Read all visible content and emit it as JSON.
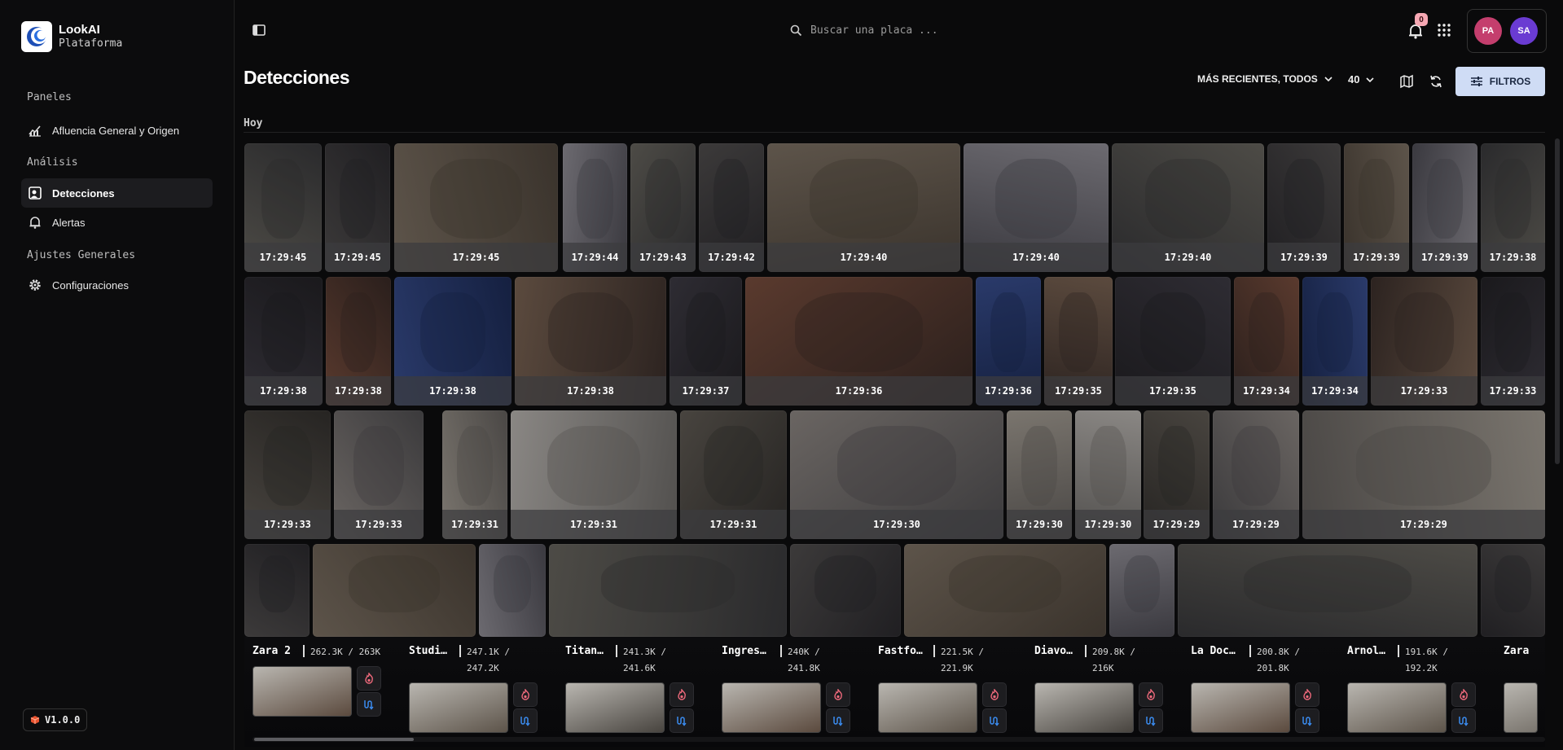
{
  "brand": {
    "name": "LookAI",
    "subtitle": "Plataforma"
  },
  "sidebar": {
    "sections": {
      "paneles": "Paneles",
      "analisis": "Análisis",
      "ajustes": "Ajustes Generales"
    },
    "items": [
      {
        "label": "Afluencia General y Origen",
        "icon": "chart-line-icon"
      },
      {
        "label": "Detecciones",
        "icon": "detections-icon",
        "active": true
      },
      {
        "label": "Alertas",
        "icon": "bell-icon"
      },
      {
        "label": "Configuraciones",
        "icon": "gear-icon"
      }
    ],
    "version": "V1.0.0"
  },
  "topbar": {
    "search_placeholder": "Buscar una placa ...",
    "notifications_count": "0",
    "avatars": [
      "PA",
      "SA"
    ]
  },
  "header": {
    "title": "Detecciones",
    "sort_label": "MÁS RECIENTES, TODOS",
    "count": "40",
    "filters_label": "FILTROS"
  },
  "day_label": "Hoy",
  "rows": [
    [
      "17:29:45",
      "17:29:45",
      "17:29:45",
      "17:29:44",
      "17:29:43",
      "17:29:42",
      "17:29:40",
      "17:29:40",
      "17:29:40",
      "17:29:39",
      "17:29:39",
      "17:29:39",
      "17:29:38"
    ],
    [
      "17:29:38",
      "17:29:38",
      "17:29:38",
      "17:29:38",
      "17:29:37",
      "17:29:36",
      "17:29:36",
      "17:29:35",
      "17:29:35",
      "17:29:34",
      "17:29:34",
      "17:29:33",
      "17:29:33"
    ],
    [
      "17:29:33",
      "17:29:33",
      "17:29:31",
      "17:29:31",
      "17:29:31",
      "17:29:30",
      "17:29:30",
      "17:29:30",
      "17:29:29",
      "17:29:29",
      "17:29:29"
    ]
  ],
  "locations": [
    {
      "name": "Zara 2",
      "stats": "262.3K / 263K"
    },
    {
      "name": "Studi…",
      "stats": "247.1K / 247.2K"
    },
    {
      "name": "Titan…",
      "stats": "241.3K / 241.6K"
    },
    {
      "name": "Ingres…",
      "stats": "240K / 241.8K"
    },
    {
      "name": "Fastfo…",
      "stats": "221.5K / 221.9K"
    },
    {
      "name": "Diavo…",
      "stats": "209.8K / 216K"
    },
    {
      "name": "La Doc…",
      "stats": "200.8K / 201.8K"
    },
    {
      "name": "Arnol…",
      "stats": "191.6K / 192.2K"
    },
    {
      "name": "Zara",
      "stats": ""
    }
  ],
  "colors": {
    "accent_filters_bg": "#cfdcf5",
    "avatar_pa": "#c43e6d",
    "avatar_sa": "#6a3bd2",
    "badge": "#f7a8b4"
  }
}
